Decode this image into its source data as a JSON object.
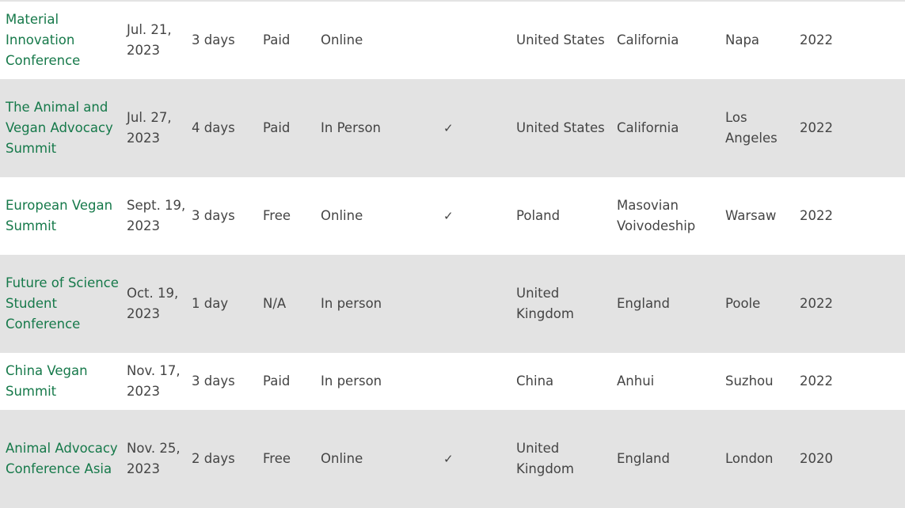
{
  "rows": [
    {
      "name": "Material Innovation Conference",
      "date": "Jul. 21, 2023",
      "duration": "3 days",
      "price": "Paid",
      "format": "Online",
      "check": "",
      "country": "United States",
      "region": "California",
      "city": "Napa",
      "year": "2022"
    },
    {
      "name": "The Animal and Vegan Advocacy Summit",
      "date": "Jul. 27, 2023",
      "duration": "4 days",
      "price": "Paid",
      "format": "In Person",
      "check": "✓",
      "country": "United States",
      "region": "California",
      "city": "Los Angeles",
      "year": "2022"
    },
    {
      "name": "European Vegan Summit",
      "date": "Sept. 19, 2023",
      "duration": "3 days",
      "price": "Free",
      "format": "Online",
      "check": "✓",
      "country": "Poland",
      "region": "Masovian Voivodeship",
      "city": "Warsaw",
      "year": "2022"
    },
    {
      "name": "Future of Science Student Conference",
      "date": "Oct. 19, 2023",
      "duration": "1 day",
      "price": "N/A",
      "format": "In person",
      "check": "",
      "country": "United Kingdom",
      "region": "England",
      "city": "Poole",
      "year": "2022"
    },
    {
      "name": "China Vegan Summit",
      "date": "Nov. 17, 2023",
      "duration": "3 days",
      "price": "Paid",
      "format": "In person",
      "check": "",
      "country": "China",
      "region": "Anhui",
      "city": "Suzhou",
      "year": "2022"
    },
    {
      "name": "Animal Advocacy Conference Asia",
      "date": "Nov. 25, 2023",
      "duration": "2 days",
      "price": "Free",
      "format": "Online",
      "check": "✓",
      "country": "United Kingdom",
      "region": "England",
      "city": "London",
      "year": "2020"
    }
  ]
}
